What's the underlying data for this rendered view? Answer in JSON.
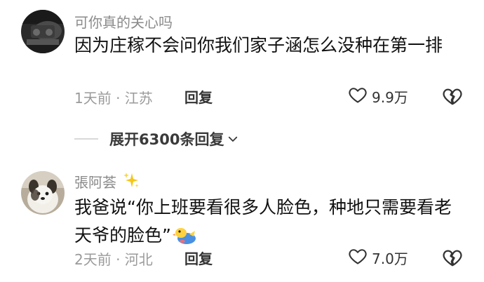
{
  "comments": [
    {
      "username": "可你真的关心吗",
      "text": "因为庄稼不会问你我们家子涵怎么没种在第一排",
      "time_location": "1天前 · 江苏",
      "reply_label": "回复",
      "like_count": "9.9万"
    },
    {
      "username": "張阿荟",
      "username_icon": "sparkle-icon",
      "text": "我爸说“你上班要看很多人脸色，种地只需要看老天爷的脸色”",
      "sticker_icon": "yellow-duck-sticker",
      "time_location": "2天前 · 河北",
      "reply_label": "回复",
      "like_count": "7.0万"
    }
  ],
  "expand_replies": {
    "label": "展开6300条回复"
  },
  "colors": {
    "username": "#8a8a8a",
    "text": "#111111",
    "meta": "#9a9a9a",
    "sparkle": "#f5c518"
  }
}
